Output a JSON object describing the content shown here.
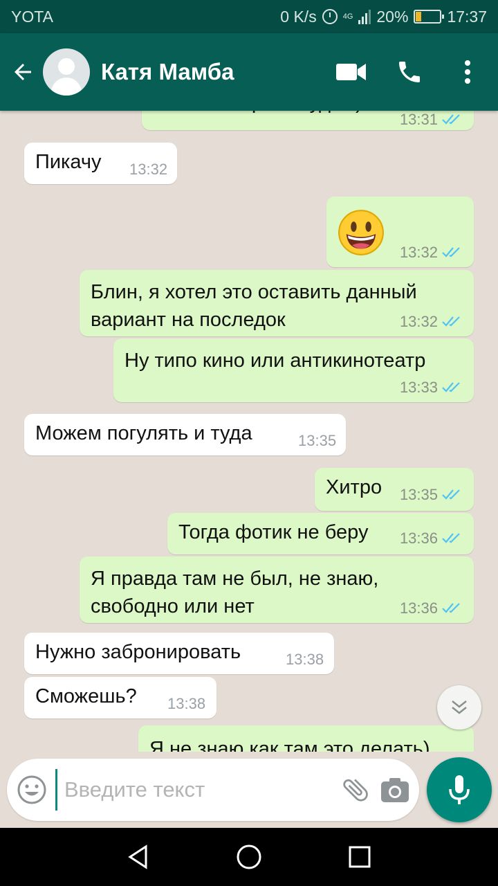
{
  "status_bar": {
    "carrier": "YOTA",
    "speed": "0 K/s",
    "network": "4G",
    "battery": "20%",
    "time": "17:37"
  },
  "header": {
    "contact_name": "Катя Мамба",
    "back_icon": "arrow-back-icon",
    "video_icon": "video-call-icon",
    "call_icon": "phone-icon",
    "menu_icon": "more-vert-icon"
  },
  "messages": [
    {
      "dir": "out",
      "text": "А что смотреть будем)",
      "time": "13:31",
      "read": true
    },
    {
      "dir": "in",
      "text": "Пикачу",
      "time": "13:32"
    },
    {
      "dir": "out",
      "text": "",
      "emoji": "grinning-face-emoji",
      "time": "13:32",
      "read": true
    },
    {
      "dir": "out",
      "text": "Блин, я хотел это оставить данный\nвариант на последок",
      "time": "13:32",
      "read": true
    },
    {
      "dir": "out",
      "text": "Ну типо кино или антикинотеатр",
      "time": "13:33",
      "read": true
    },
    {
      "dir": "in",
      "text": "Можем погулять и туда",
      "time": "13:35"
    },
    {
      "dir": "out",
      "text": "Хитро",
      "time": "13:35",
      "read": true
    },
    {
      "dir": "out",
      "text": "Тогда фотик не беру",
      "time": "13:36",
      "read": true
    },
    {
      "dir": "out",
      "text": "Я правда там не был, не знаю,\nсвободно или нет",
      "time": "13:36",
      "read": true
    },
    {
      "dir": "in",
      "text": "Нужно забронировать",
      "time": "13:38"
    },
    {
      "dir": "in",
      "text": "Сможешь?",
      "time": "13:38"
    },
    {
      "dir": "out",
      "text": "Я не знаю как там это делать)",
      "time": "",
      "read": true
    }
  ],
  "composer": {
    "placeholder": "Введите текст",
    "value": ""
  },
  "colors": {
    "header": "#075e54",
    "status_bar": "#054d44",
    "incoming_bubble": "#ffffff",
    "outgoing_bubble": "#dcf8c6",
    "read_ticks": "#4fc3f7",
    "mic_button": "#00897b",
    "chat_background": "#e5ddd5"
  }
}
